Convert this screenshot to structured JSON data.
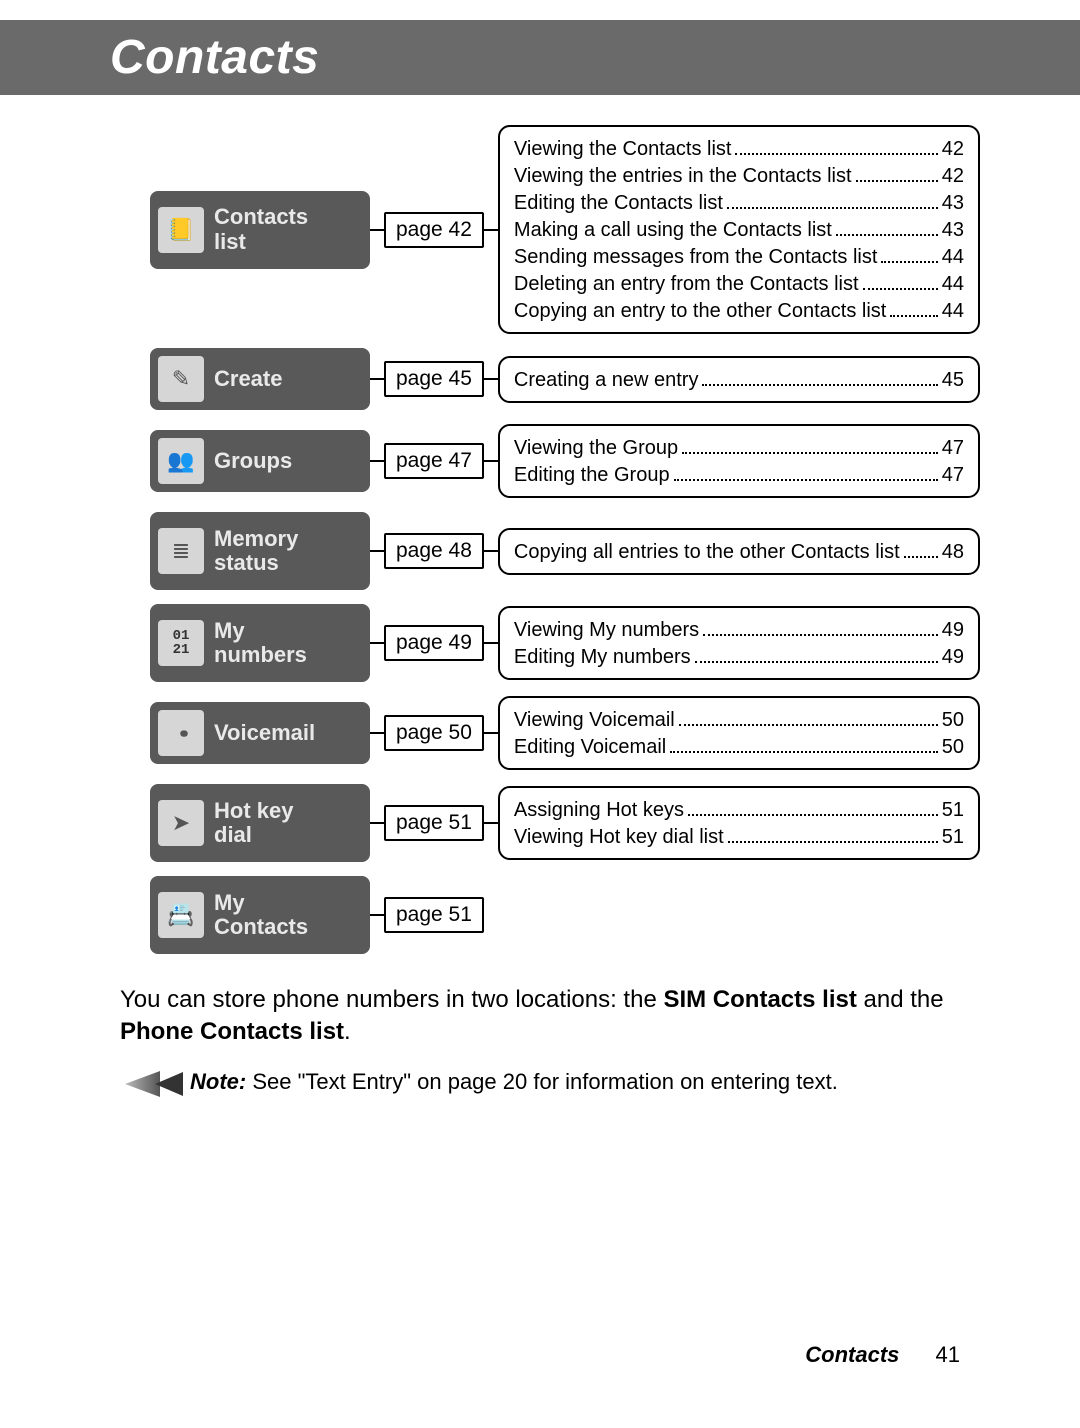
{
  "header": {
    "title": "Contacts"
  },
  "sections": [
    {
      "label": "Contacts\nlist",
      "page": "page 42",
      "icon": "book-icon",
      "tall": true,
      "sub": [
        {
          "label": "Viewing the Contacts list",
          "page": "42"
        },
        {
          "label": "Viewing the entries in the Contacts list",
          "page": "42"
        },
        {
          "label": "Editing the Contacts list",
          "page": "43"
        },
        {
          "label": "Making a call using the Contacts list",
          "page": "43"
        },
        {
          "label": "Sending messages from the Contacts list",
          "page": "44"
        },
        {
          "label": "Deleting an entry from the Contacts list",
          "page": "44"
        },
        {
          "label": "Copying an entry to the other Contacts list",
          "page": "44"
        }
      ]
    },
    {
      "label": "Create",
      "page": "page 45",
      "icon": "create-icon",
      "tall": false,
      "sub": [
        {
          "label": "Creating a new entry",
          "page": "45"
        }
      ]
    },
    {
      "label": "Groups",
      "page": "page 47",
      "icon": "groups-icon",
      "tall": false,
      "sub": [
        {
          "label": "Viewing the Group",
          "page": "47"
        },
        {
          "label": "Editing the Group",
          "page": "47"
        }
      ]
    },
    {
      "label": "Memory\nstatus",
      "page": "page 48",
      "icon": "memory-icon",
      "tall": true,
      "sub": [
        {
          "label": "Copying all entries to the other Contacts list",
          "page": "48"
        }
      ]
    },
    {
      "label": "My\nnumbers",
      "page": "page 49",
      "icon": "numbers-icon",
      "tall": true,
      "sub": [
        {
          "label": "Viewing My numbers",
          "page": "49"
        },
        {
          "label": "Editing My numbers",
          "page": "49"
        }
      ]
    },
    {
      "label": "Voicemail",
      "page": "page 50",
      "icon": "voicemail-icon",
      "tall": false,
      "sub": [
        {
          "label": "Viewing Voicemail",
          "page": "50"
        },
        {
          "label": "Editing Voicemail",
          "page": "50"
        }
      ]
    },
    {
      "label": "Hot key\ndial",
      "page": "page 51",
      "icon": "hotkey-icon",
      "tall": true,
      "sub": [
        {
          "label": "Assigning Hot keys",
          "page": "51"
        },
        {
          "label": "Viewing Hot key dial list",
          "page": "51"
        }
      ]
    },
    {
      "label": "My\nContacts",
      "page": "page 51",
      "icon": "mycontacts-icon",
      "tall": true,
      "sub": null
    }
  ],
  "body": {
    "pre": "You can store phone numbers in two locations: the ",
    "bold1": "SIM Contacts list",
    "mid": " and the ",
    "bold2": "Phone Contacts list",
    "post": "."
  },
  "note": {
    "lead": "Note:",
    "text": " See \"Text Entry\" on page 20 for information on entering text."
  },
  "footer": {
    "section": "Contacts",
    "page": "41"
  },
  "icon_glyphs": {
    "numbers": "01\n21"
  }
}
